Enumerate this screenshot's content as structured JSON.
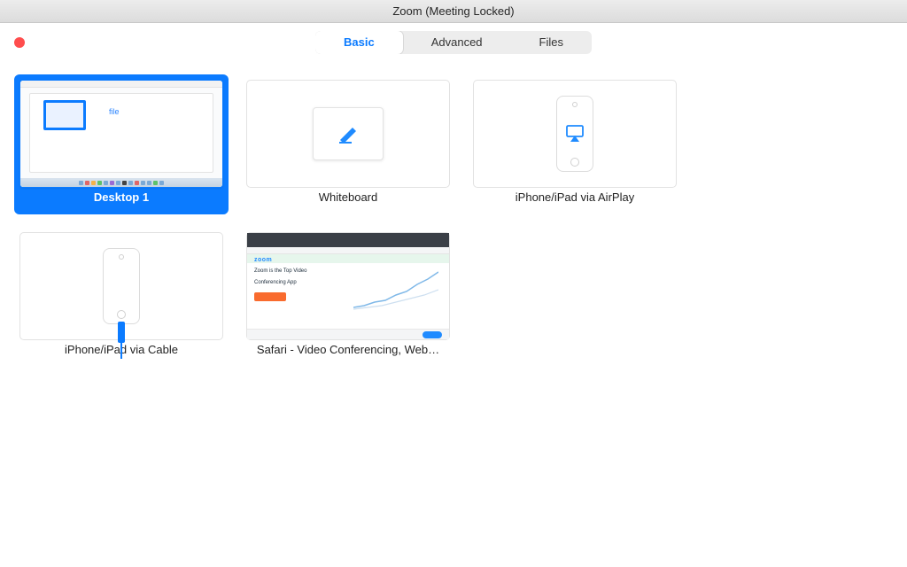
{
  "window": {
    "title": "Zoom (Meeting Locked)"
  },
  "tabs": {
    "basic": "Basic",
    "advanced": "Advanced",
    "files": "Files",
    "active": "basic"
  },
  "tiles": {
    "desktop1": {
      "label": "Desktop 1",
      "preview_text": "file"
    },
    "whiteboard": {
      "label": "Whiteboard"
    },
    "airplay": {
      "label": "iPhone/iPad via AirPlay"
    },
    "cable": {
      "label": "iPhone/iPad via Cable"
    },
    "safari": {
      "label": "Safari - Video Conferencing, Web…",
      "brand": "zoom",
      "headline1": "Zoom is the Top Video",
      "headline2": "Conferencing App"
    }
  },
  "colors": {
    "accent": "#0b7bff",
    "record": "#ff4d4d"
  }
}
